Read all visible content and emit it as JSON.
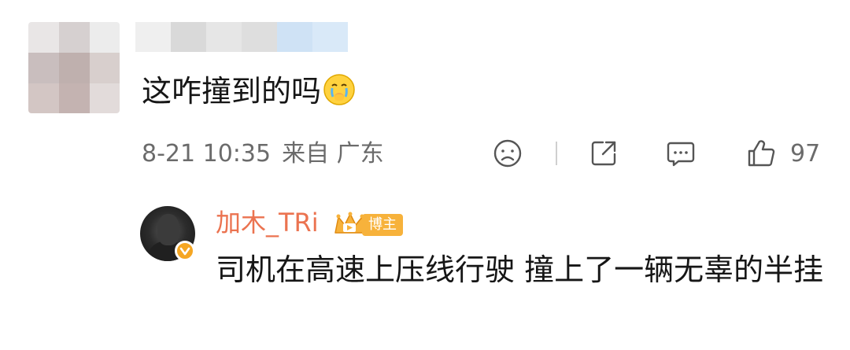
{
  "comment": {
    "text": "这咋撞到的吗",
    "emoji_name": "crying-face-emoji",
    "timestamp": "8-21 10:35",
    "location": "来自 广东",
    "like_count": "97"
  },
  "reply": {
    "author": "加木_TRi",
    "author_badge": "博主",
    "text": "司机在高速上压线行驶 撞上了一辆无辜的半挂"
  },
  "colors": {
    "reply_name": "#eb7350",
    "badge_bg": "#f7b23b",
    "meta_text": "#6b6b6b",
    "icon_stroke": "#555555"
  },
  "icons": [
    "dislike-icon",
    "share-icon",
    "comment-icon",
    "like-icon",
    "crown-icon",
    "verified-icon"
  ]
}
